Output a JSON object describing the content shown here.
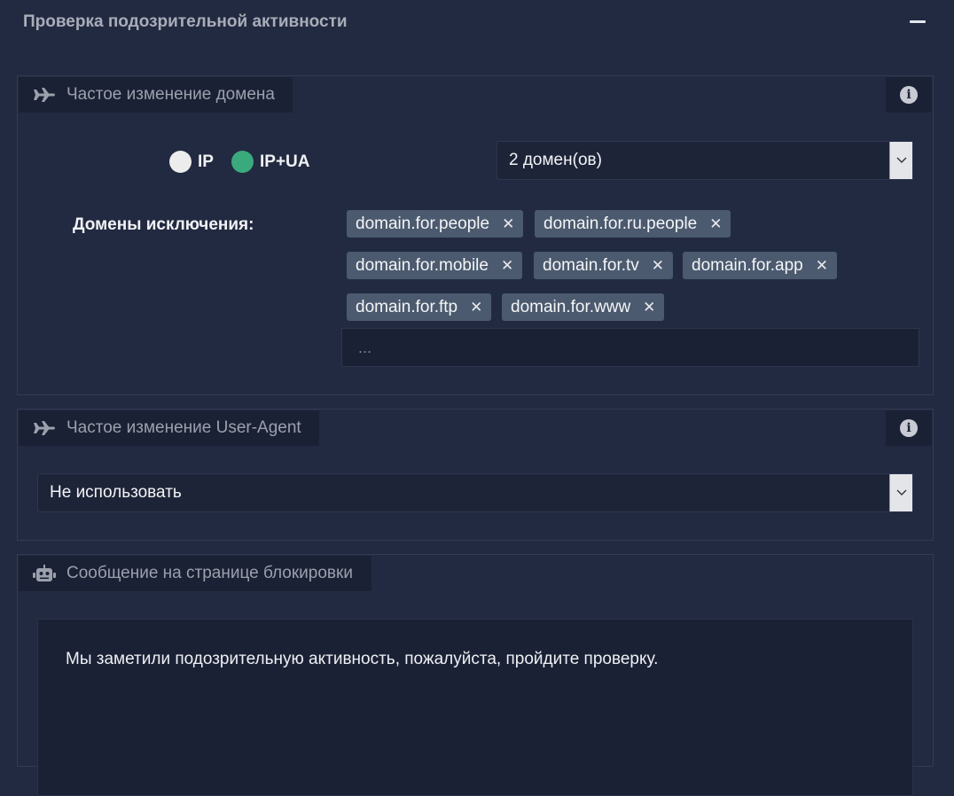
{
  "section": {
    "title": "Проверка подозрительной активности"
  },
  "domain_panel": {
    "title": "Частое изменение домена",
    "mode_options": [
      {
        "label": "IP",
        "selected": false,
        "color": "#ececec"
      },
      {
        "label": "IP+UA",
        "selected": true,
        "color": "#3aaa7c"
      }
    ],
    "count_select": {
      "value": "2 домен(ов)"
    },
    "exclusions_label": "Домены исключения:",
    "tags": [
      "domain.for.people",
      "domain.for.ru.people",
      "domain.for.mobile",
      "domain.for.tv",
      "domain.for.app",
      "domain.for.ftp",
      "domain.for.www"
    ],
    "tag_input_placeholder": "..."
  },
  "ua_panel": {
    "title": "Частое изменение User-Agent",
    "select": {
      "value": "Не использовать"
    }
  },
  "block_panel": {
    "title": "Сообщение на странице блокировки",
    "message": "Мы заметили подозрительную активность, пожалуйста, пройдите проверку."
  },
  "icons": {
    "collapse": "minus-icon",
    "plane": "plane-icon",
    "robot": "robot-icon",
    "info": "info-icon",
    "chevron": "chevron-down-icon",
    "remove": "close-icon"
  }
}
